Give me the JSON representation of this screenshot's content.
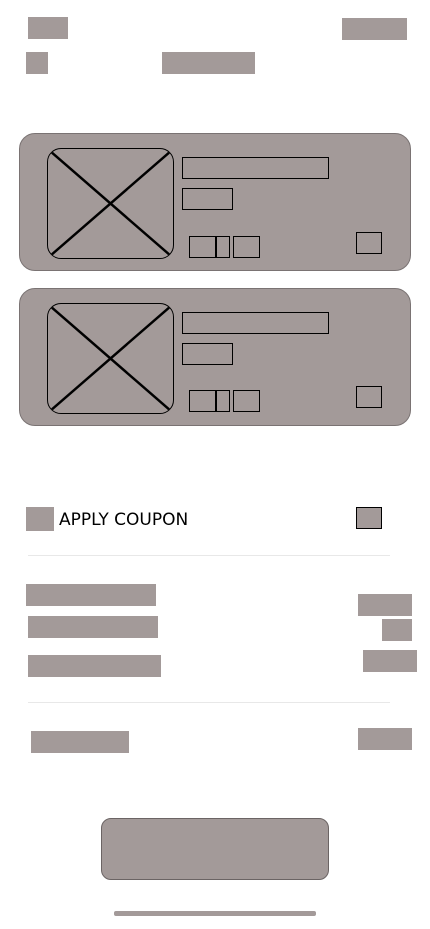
{
  "colors": {
    "placeholder": "#a39a99"
  },
  "coupon": {
    "label": "APPLY COUPON"
  },
  "cart": {
    "items": [
      {
        "thumbnail_icon": "image-placeholder-icon"
      },
      {
        "thumbnail_icon": "image-placeholder-icon"
      }
    ]
  }
}
